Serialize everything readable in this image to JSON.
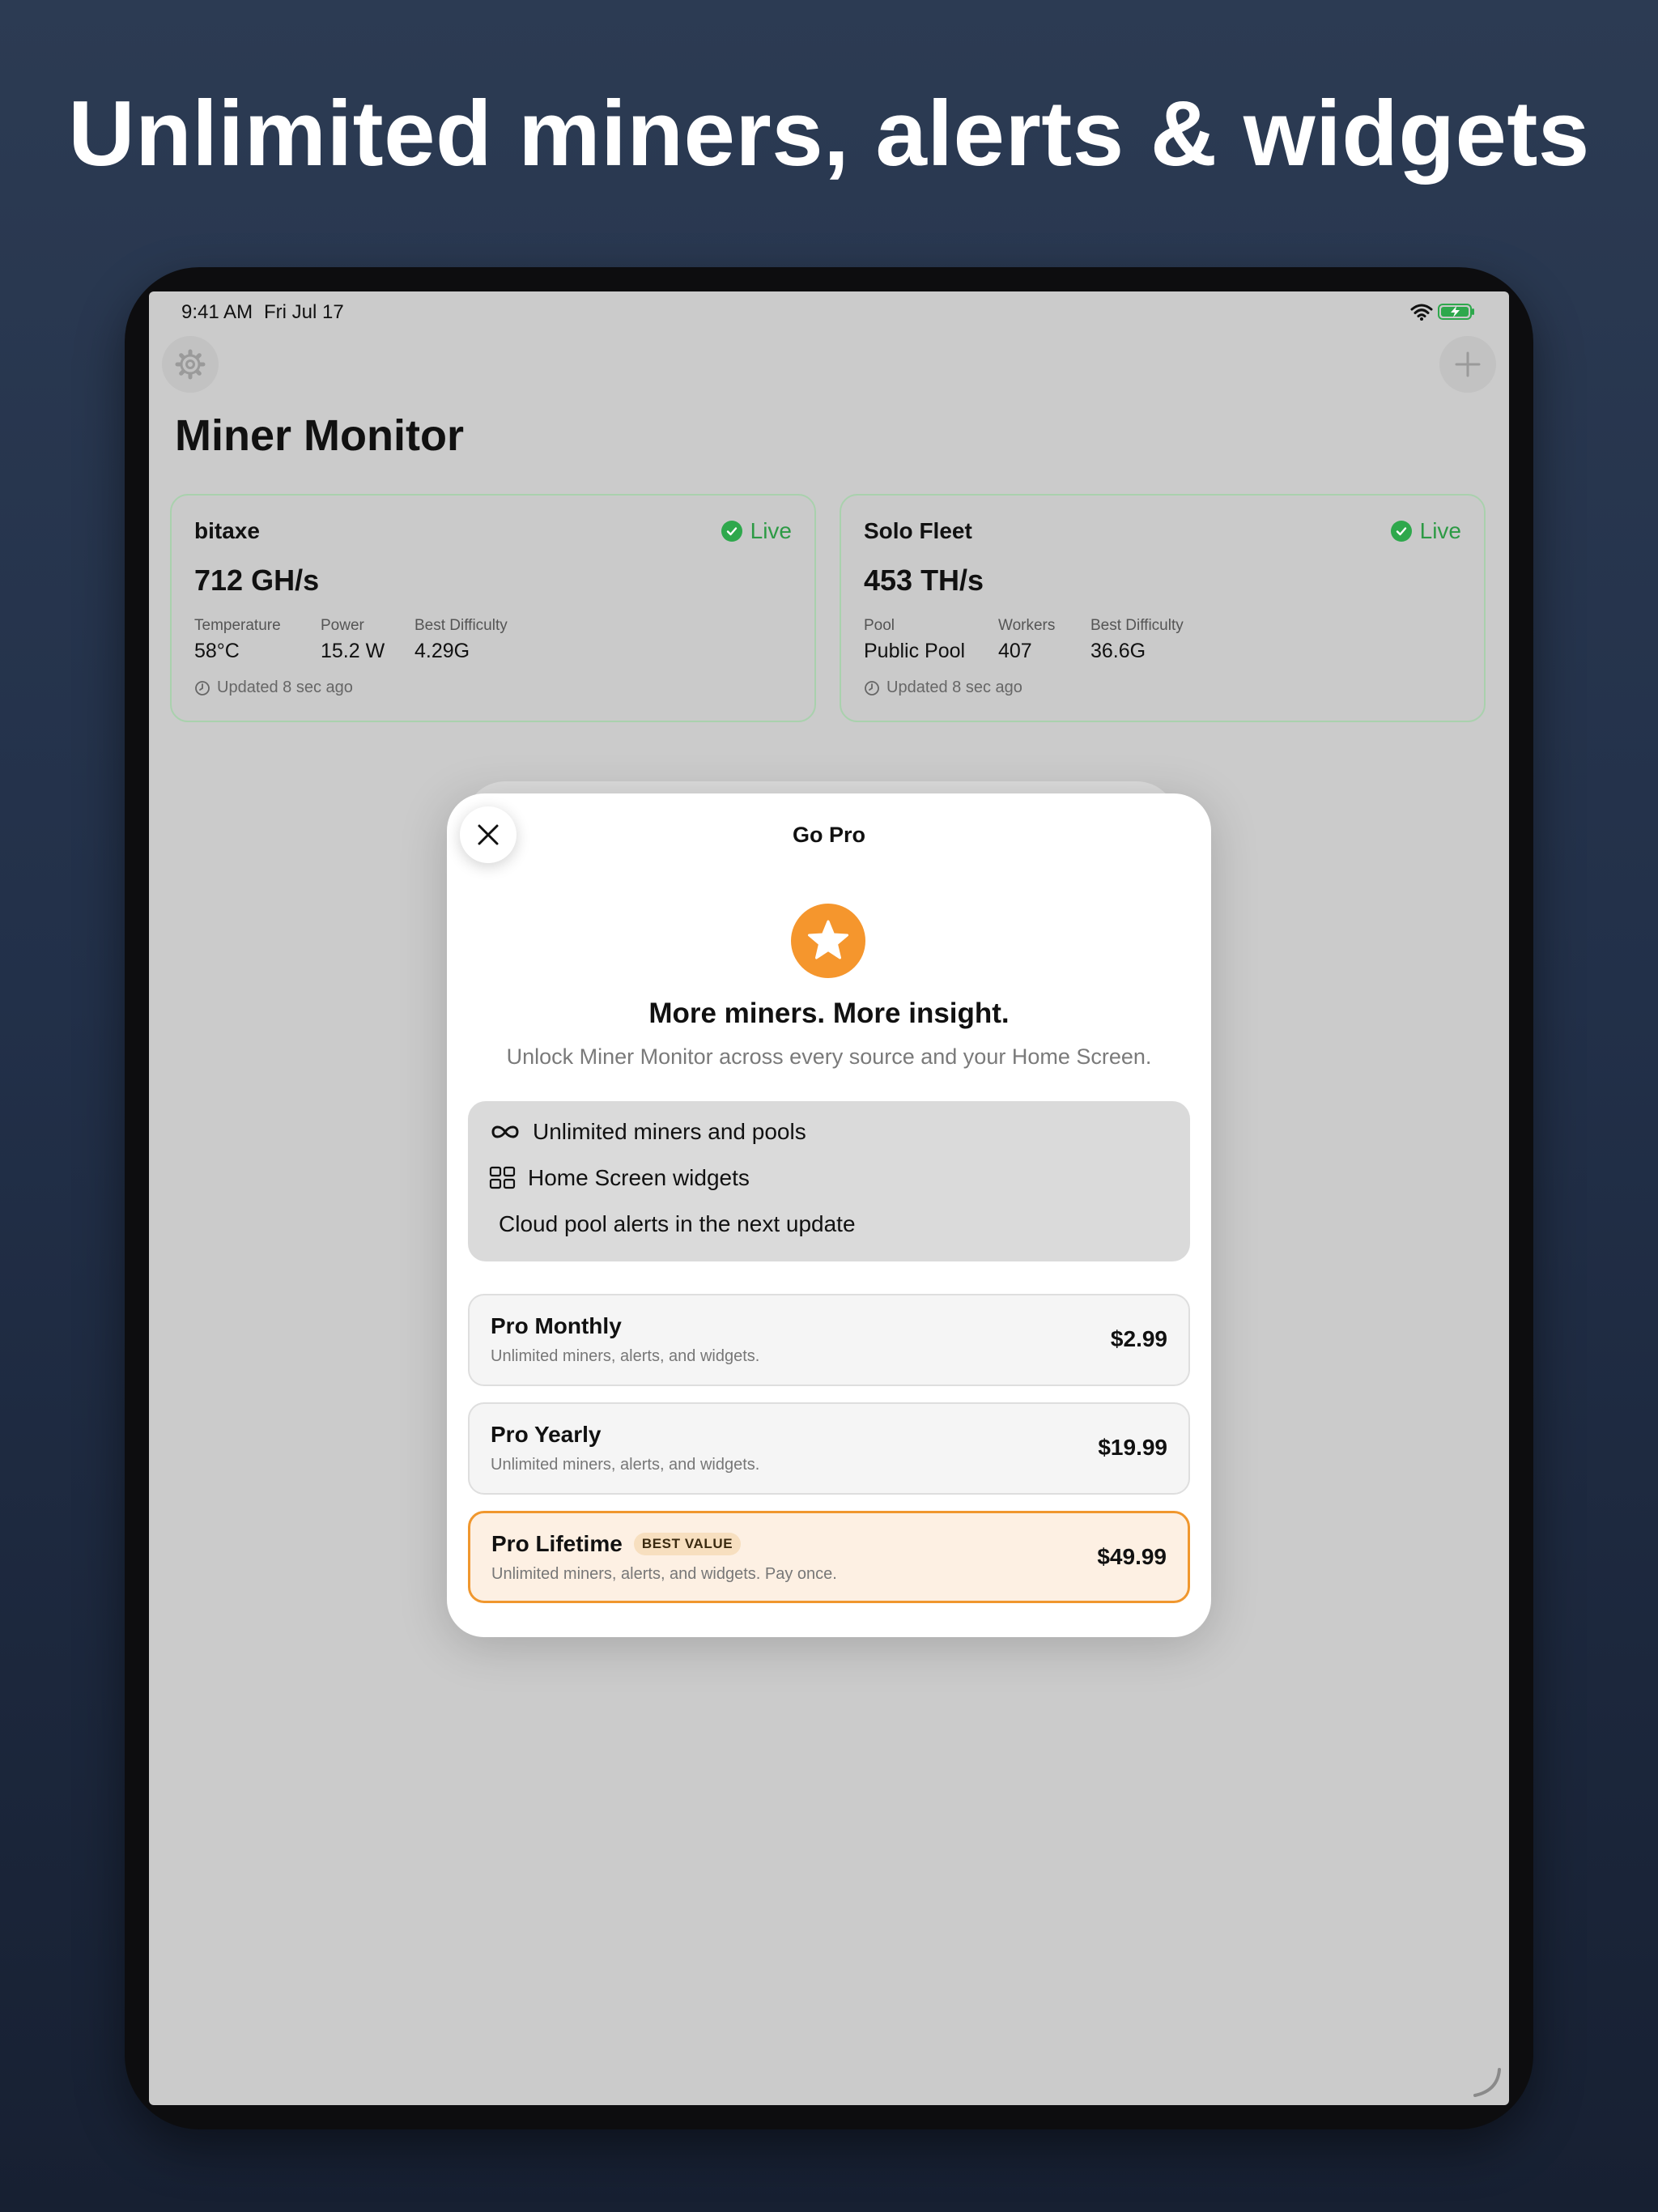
{
  "headline": "Unlimited miners, alerts & widgets",
  "status": {
    "time": "9:41 AM",
    "date": "Fri Jul 17"
  },
  "app": {
    "title": "Miner Monitor"
  },
  "cards": [
    {
      "name": "bitaxe",
      "status": "Live",
      "rate": "712 GH/s",
      "stats": [
        {
          "label": "Temperature",
          "value": "58°C"
        },
        {
          "label": "Power",
          "value": "15.2 W"
        },
        {
          "label": "Best Difficulty",
          "value": "4.29G"
        }
      ],
      "updated": "Updated 8 sec ago"
    },
    {
      "name": "Solo Fleet",
      "status": "Live",
      "rate": "453 TH/s",
      "stats": [
        {
          "label": "Pool",
          "value": "Public Pool"
        },
        {
          "label": "Workers",
          "value": "407"
        },
        {
          "label": "Best Difficulty",
          "value": "36.6G"
        }
      ],
      "updated": "Updated 8 sec ago"
    }
  ],
  "paywall": {
    "title": "Go Pro",
    "heading": "More miners. More insight.",
    "subtitle": "Unlock Miner Monitor across every source and your Home Screen.",
    "features": [
      {
        "icon": "infinity-icon",
        "text": "Unlimited miners and pools"
      },
      {
        "icon": "widgets-grid-icon",
        "text": "Home Screen widgets"
      },
      {
        "icon": "",
        "text": "Cloud pool alerts in the next update"
      }
    ],
    "plans": [
      {
        "name": "Pro Monthly",
        "description": "Unlimited miners, alerts, and widgets.",
        "price": "$2.99"
      },
      {
        "name": "Pro Yearly",
        "description": "Unlimited miners, alerts, and widgets.",
        "price": "$19.99"
      },
      {
        "name": "Pro Lifetime",
        "badge": "BEST VALUE",
        "description": "Unlimited miners, alerts, and widgets. Pay once.",
        "price": "$49.99",
        "selected": true
      }
    ]
  },
  "colors": {
    "background_top": "#2c3b53",
    "background_bottom": "#172032",
    "live_green": "#2ea84c",
    "accent_orange": "#f5962d",
    "selected_plan_fill": "#fdf0e3"
  }
}
